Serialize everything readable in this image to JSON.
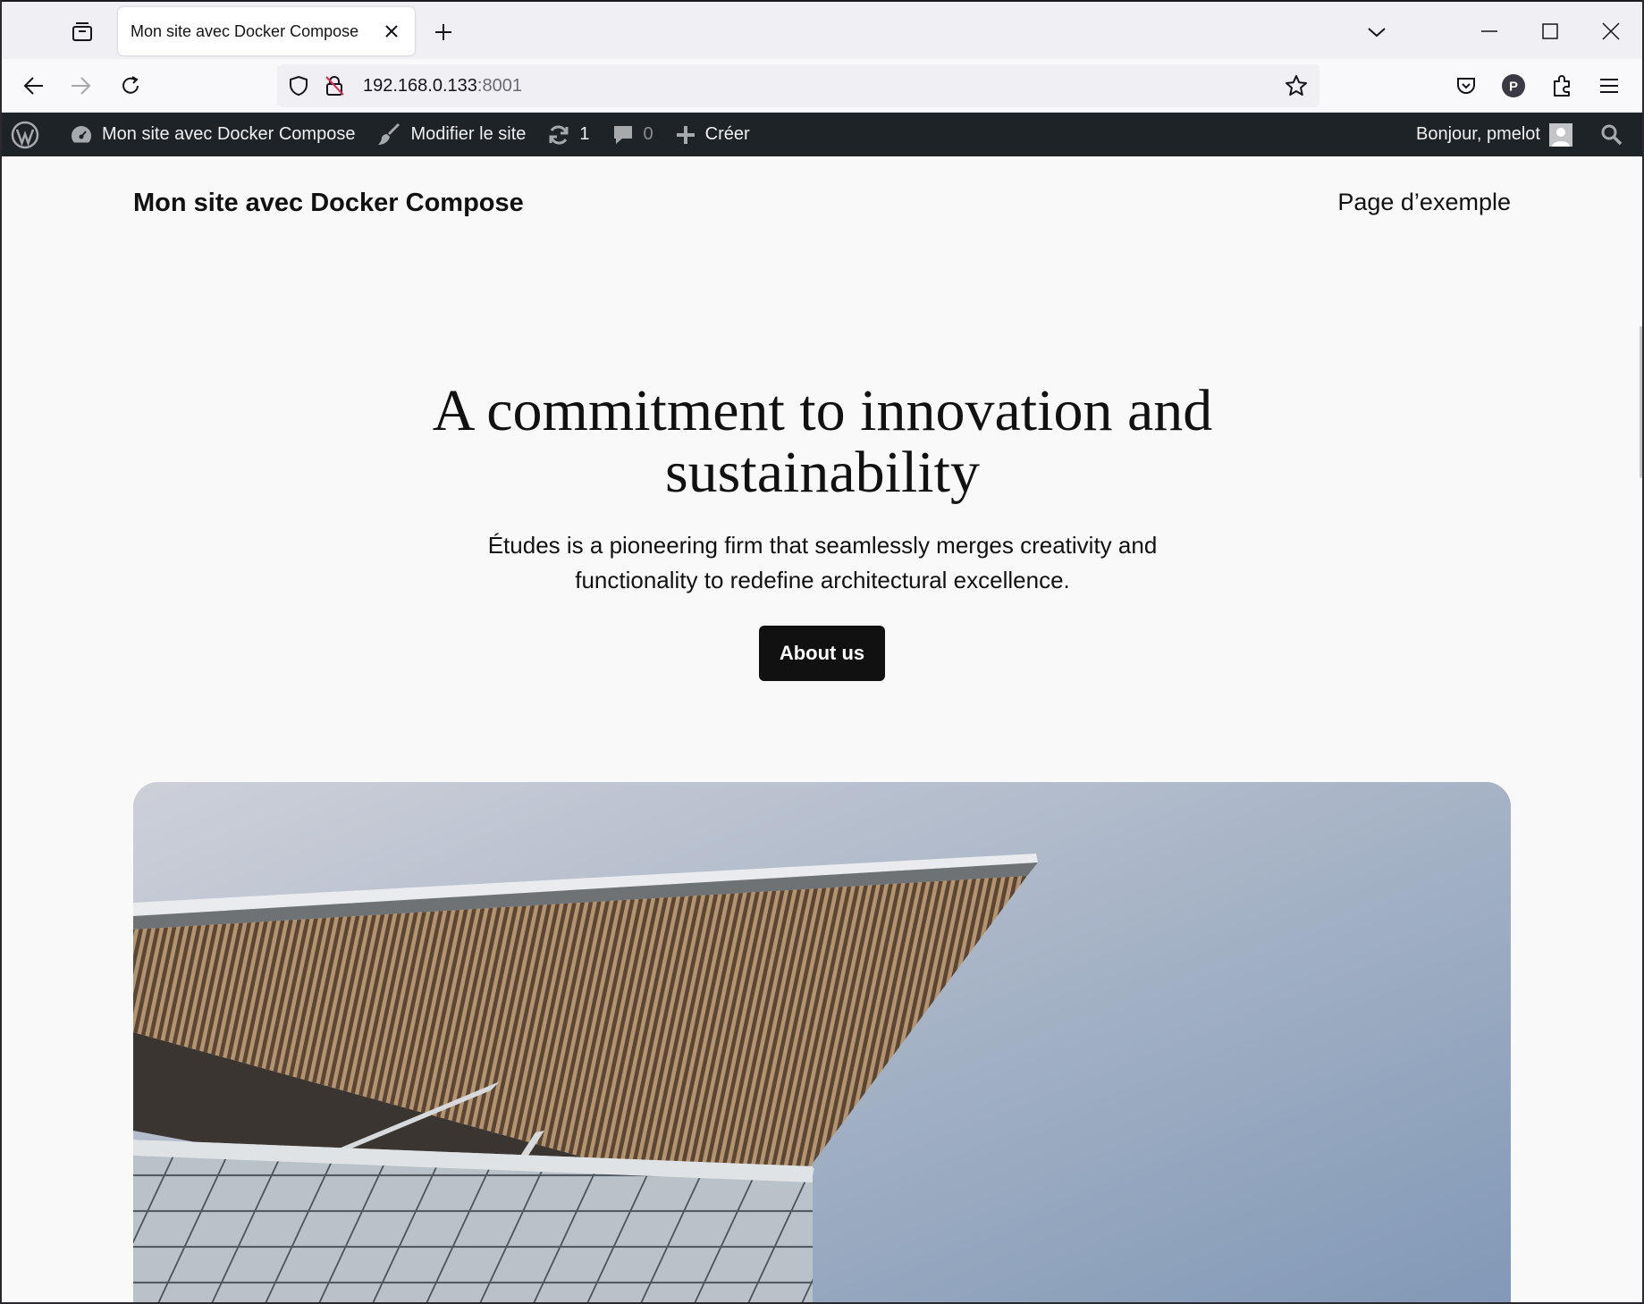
{
  "browser": {
    "tab_title": "Mon site avec Docker Compose",
    "url_host": "192.168.0.133",
    "url_port": ":8001",
    "icons": [
      "tab-list-icon",
      "close-icon",
      "plus-icon",
      "chevron-down-icon",
      "minimize-icon",
      "maximize-icon",
      "window-close-icon",
      "back-arrow-icon",
      "forward-arrow-icon",
      "reload-icon",
      "shield-icon",
      "insecure-lock-icon",
      "star-icon",
      "pocket-icon",
      "profile-avatar-icon",
      "extensions-icon",
      "menu-icon"
    ],
    "profile_initial": "P"
  },
  "adminbar": {
    "site_name": "Mon site avec Docker Compose",
    "edit_site": "Modifier le site",
    "updates_count": "1",
    "comments_count": "0",
    "create": "Créer",
    "greeting": "Bonjour, pmelot"
  },
  "site": {
    "title": "Mon site avec Docker Compose",
    "nav_link": "Page d’exemple",
    "hero_heading": "A commitment to innovation and sustainability",
    "hero_text": "Études is a pioneering firm that seamlessly merges creativity and functionality to redefine architectural excellence.",
    "button_label": "About us"
  },
  "colors": {
    "adminbar_bg": "#1d2327",
    "page_bg": "#f9f9f9",
    "button_bg": "#111111",
    "sky": "#8aa0bc",
    "facade_wood": "#9a7a55"
  }
}
